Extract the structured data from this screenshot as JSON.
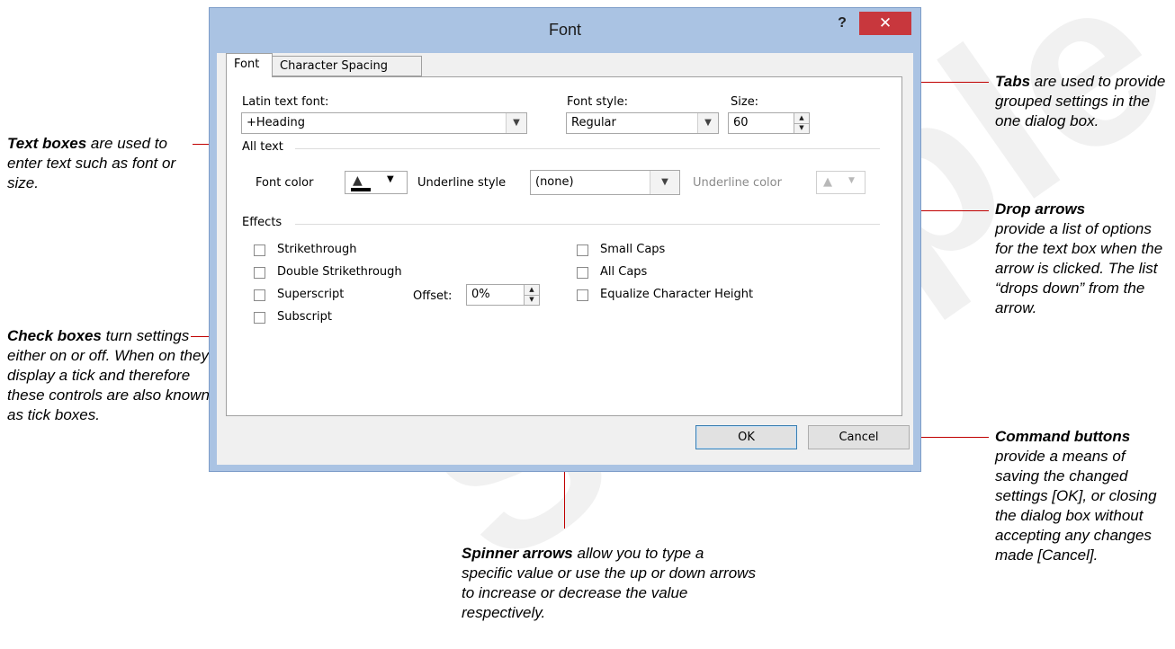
{
  "dialog": {
    "title": "Font",
    "help_label": "?",
    "close_label": "✕",
    "tabs": [
      {
        "label": "Font",
        "selected": true
      },
      {
        "label": "Character Spacing",
        "selected": false
      }
    ],
    "latin_font_label": "Latin text font:",
    "latin_font_value": "+Heading",
    "font_style_label": "Font style:",
    "font_style_value": "Regular",
    "size_label": "Size:",
    "size_value": "60",
    "all_text_label": "All text",
    "font_color_label": "Font color",
    "underline_style_label": "Underline style",
    "underline_style_value": "(none)",
    "underline_color_label": "Underline color",
    "effects_label": "Effects",
    "effects_left": [
      {
        "label": "Strikethrough",
        "checked": false
      },
      {
        "label": "Double Strikethrough",
        "checked": false
      },
      {
        "label": "Superscript",
        "checked": false
      },
      {
        "label": "Subscript",
        "checked": false
      }
    ],
    "effects_right": [
      {
        "label": "Small Caps",
        "checked": false
      },
      {
        "label": "All Caps",
        "checked": false
      },
      {
        "label": "Equalize Character Height",
        "checked": false
      }
    ],
    "offset_label": "Offset:",
    "offset_value": "0%",
    "ok_label": "OK",
    "cancel_label": "Cancel",
    "font_color_swatch": "#000000"
  },
  "callouts": {
    "text_boxes": {
      "bold": "Text boxes",
      "rest": " are used to enter text such as font or size."
    },
    "check_boxes": {
      "bold": "Check boxes",
      "rest": " turn settings either on or off. When on they display a tick and therefore these controls are also known as tick boxes."
    },
    "tabs": {
      "bold": "Tabs",
      "rest": " are used to provide grouped settings in the one dialog box."
    },
    "drop_arrows": {
      "bold": "Drop arrows",
      "rest": "provide a list of options for the text box when the arrow is clicked. The list “drops down” from the arrow."
    },
    "command_buttons": {
      "bold": "Command buttons",
      "rest": "provide a means of saving the changed settings [OK], or closing the dialog box without accepting any changes made [Cancel]."
    },
    "spinner_arrows": {
      "bold": "Spinner arrows",
      "rest": " allow you to type a specific value or use the up or down arrows to increase or decrease the value respectively."
    }
  },
  "watermark": "Sample",
  "colors": {
    "callout_line": "#c00000",
    "close_button": "#c8373d",
    "dialog_frame": "#aac3e3"
  }
}
